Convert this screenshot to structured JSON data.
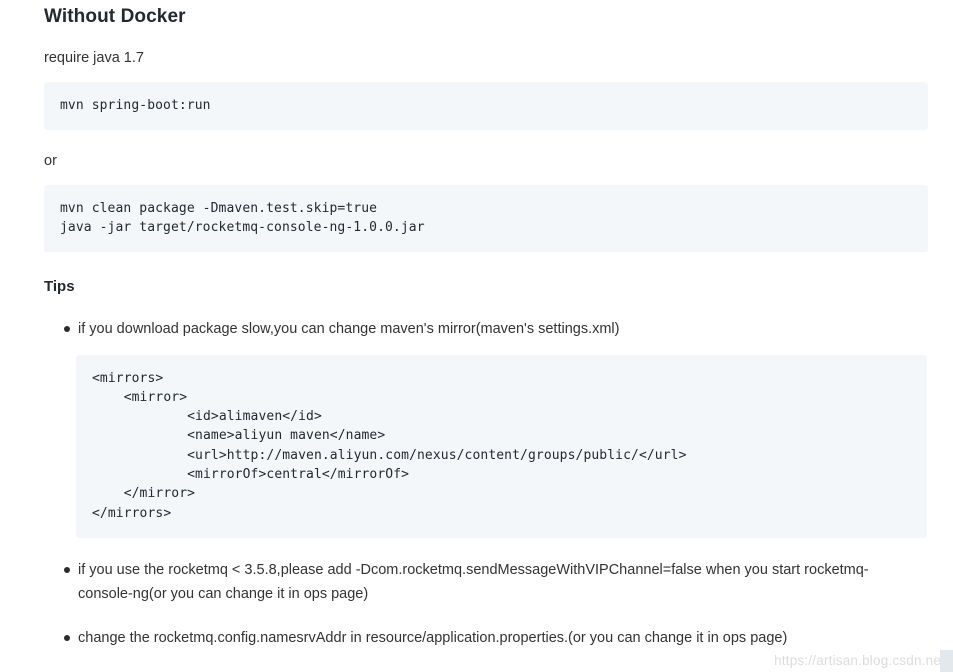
{
  "document": {
    "heading": "Without Docker",
    "requirement_text": "require java 1.7",
    "code_block_1": "mvn spring-boot:run",
    "separator_text": "or",
    "code_block_2": "mvn clean package -Dmaven.test.skip=true\njava -jar target/rocketmq-console-ng-1.0.0.jar",
    "tips_heading": "Tips",
    "tips": [
      {
        "text": "if you download package slow,you can change maven's mirror(maven's settings.xml)",
        "code": "<mirrors>\n    <mirror>\n            <id>alimaven</id>\n            <name>aliyun maven</name>\n            <url>http://maven.aliyun.com/nexus/content/groups/public/</url>\n            <mirrorOf>central</mirrorOf>\n    </mirror>\n</mirrors>"
      },
      {
        "text": "if you use the rocketmq < 3.5.8,please add -Dcom.rocketmq.sendMessageWithVIPChannel=false when you start rocketmq-console-ng(or you can change it in ops page)"
      },
      {
        "text": "change the rocketmq.config.namesrvAddr in resource/application.properties.(or you can change it in ops page)"
      }
    ],
    "watermark": "https://artisan.blog.csdn.net"
  },
  "colors": {
    "code_background": "#f4f7fa",
    "heading_color": "#24292e",
    "body_color": "#333333",
    "watermark_color": "#dcdcdc"
  }
}
